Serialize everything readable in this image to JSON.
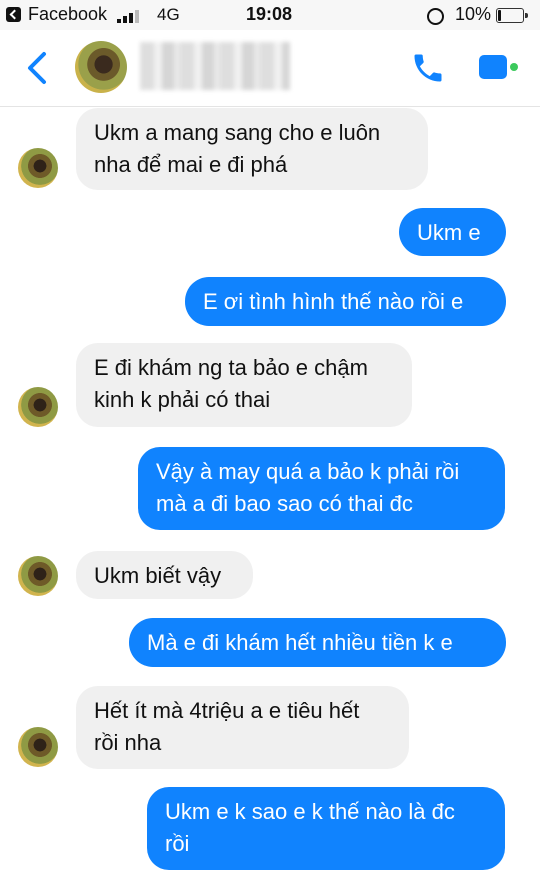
{
  "status_bar": {
    "app_name": "Facebook",
    "network": "4G",
    "time": "19:08",
    "battery_percent": "10%",
    "battery_level": 0.1,
    "signal_bars_filled": 3
  },
  "header": {
    "back_icon": "chevron-left-icon",
    "call_icon": "phone-icon",
    "video_icon": "video-camera-icon",
    "accent_color": "#1083fe"
  },
  "messages": [
    {
      "from": "them",
      "text": "Ukm a mang sang cho e luôn\nnha để mai e đi phá"
    },
    {
      "from": "me",
      "text": "Ukm e"
    },
    {
      "from": "me",
      "text": "E ơi tình hình thế nào rồi e"
    },
    {
      "from": "them",
      "text": "E đi khám ng ta bảo e chậm\nkinh k phải có thai"
    },
    {
      "from": "me",
      "text": "Vậy à may quá a bảo k phải rồi\nmà a đi bao sao có thai đc"
    },
    {
      "from": "them",
      "text": "Ukm biết vậy"
    },
    {
      "from": "me",
      "text": "Mà e đi khám hết nhiều tiền k e"
    },
    {
      "from": "them",
      "text": "Hết ít mà 4triệu a e tiêu hết\nrồi nha"
    },
    {
      "from": "me",
      "text": "Ukm e k sao e k thế nào là đc\nrồi"
    }
  ],
  "colors": {
    "incoming_bubble": "#f0f0f0",
    "outgoing_bubble": "#1083fe"
  }
}
